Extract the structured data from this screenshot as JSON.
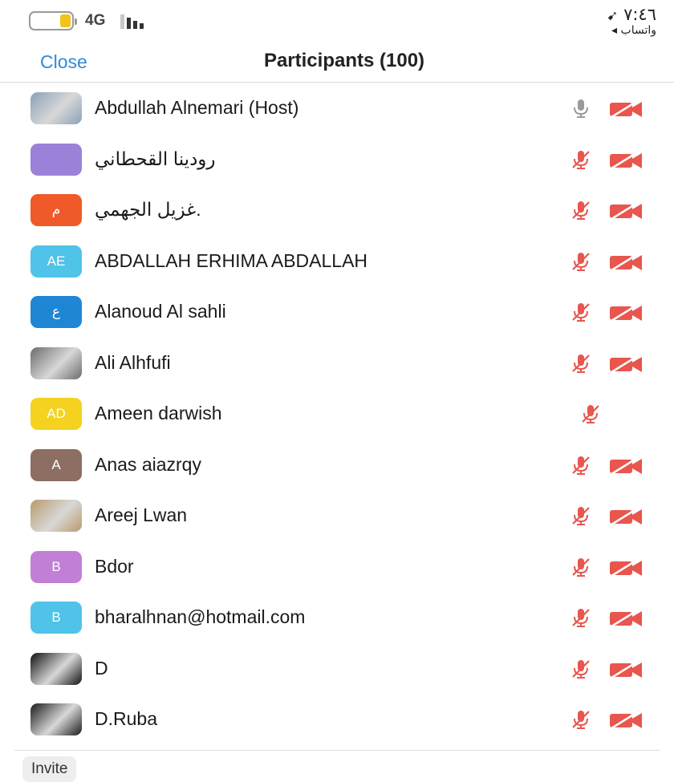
{
  "status": {
    "network": "4G",
    "time": "٧:٤٦",
    "back_app": "◂ واتساب",
    "battery_color": "#f0c419"
  },
  "nav": {
    "close_label": "Close",
    "title": "Participants (100)"
  },
  "participants": [
    {
      "name": "Abdullah Alnemari (Host)",
      "avatar_type": "photo",
      "avatar_text": "",
      "avatar_color": "#8aa0b8",
      "mic": "active",
      "video": "off"
    },
    {
      "name": "رودينا القحطاني",
      "avatar_type": "initials",
      "avatar_text": "",
      "avatar_color": "#9b82d8",
      "mic": "muted",
      "video": "off"
    },
    {
      "name": "غزيل الجهمي.",
      "avatar_type": "initials",
      "avatar_text": "م",
      "avatar_color": "#ef5a28",
      "mic": "muted",
      "video": "off"
    },
    {
      "name": "ABDALLAH ERHIMA ABDALLAH",
      "avatar_type": "initials",
      "avatar_text": "AE",
      "avatar_color": "#4fc3e8",
      "mic": "muted",
      "video": "off"
    },
    {
      "name": "Alanoud Al sahli",
      "avatar_type": "initials",
      "avatar_text": "ع",
      "avatar_color": "#1f86d6",
      "mic": "muted",
      "video": "off"
    },
    {
      "name": "Ali Alhfufi",
      "avatar_type": "photo",
      "avatar_text": "",
      "avatar_color": "#6b6b6b",
      "mic": "muted",
      "video": "off"
    },
    {
      "name": "Ameen darwish",
      "avatar_type": "initials",
      "avatar_text": "AD",
      "avatar_color": "#f5d21f",
      "mic": "muted",
      "video": "none"
    },
    {
      "name": "Anas aiazrqy",
      "avatar_type": "initials",
      "avatar_text": "A",
      "avatar_color": "#8c6e62",
      "mic": "muted",
      "video": "off"
    },
    {
      "name": "Areej Lwan",
      "avatar_type": "photo",
      "avatar_text": "",
      "avatar_color": "#b89a6a",
      "mic": "muted",
      "video": "off"
    },
    {
      "name": "Bdor",
      "avatar_type": "initials",
      "avatar_text": "B",
      "avatar_color": "#c27fd6",
      "mic": "muted",
      "video": "off"
    },
    {
      "name": "bharalhnan@hotmail.com",
      "avatar_type": "initials",
      "avatar_text": "B",
      "avatar_color": "#4fc3e8",
      "mic": "muted",
      "video": "off"
    },
    {
      "name": "D",
      "avatar_type": "photo",
      "avatar_text": "",
      "avatar_color": "#111111",
      "mic": "muted",
      "video": "off"
    },
    {
      "name": "D.Ruba",
      "avatar_type": "photo",
      "avatar_text": "",
      "avatar_color": "#1a1a1a",
      "mic": "muted",
      "video": "off"
    }
  ],
  "footer": {
    "invite_label": "Invite"
  },
  "colors": {
    "accent": "#2d8bd8",
    "muted_red": "#e8564e",
    "mic_active_gray": "#9a9a9a"
  }
}
